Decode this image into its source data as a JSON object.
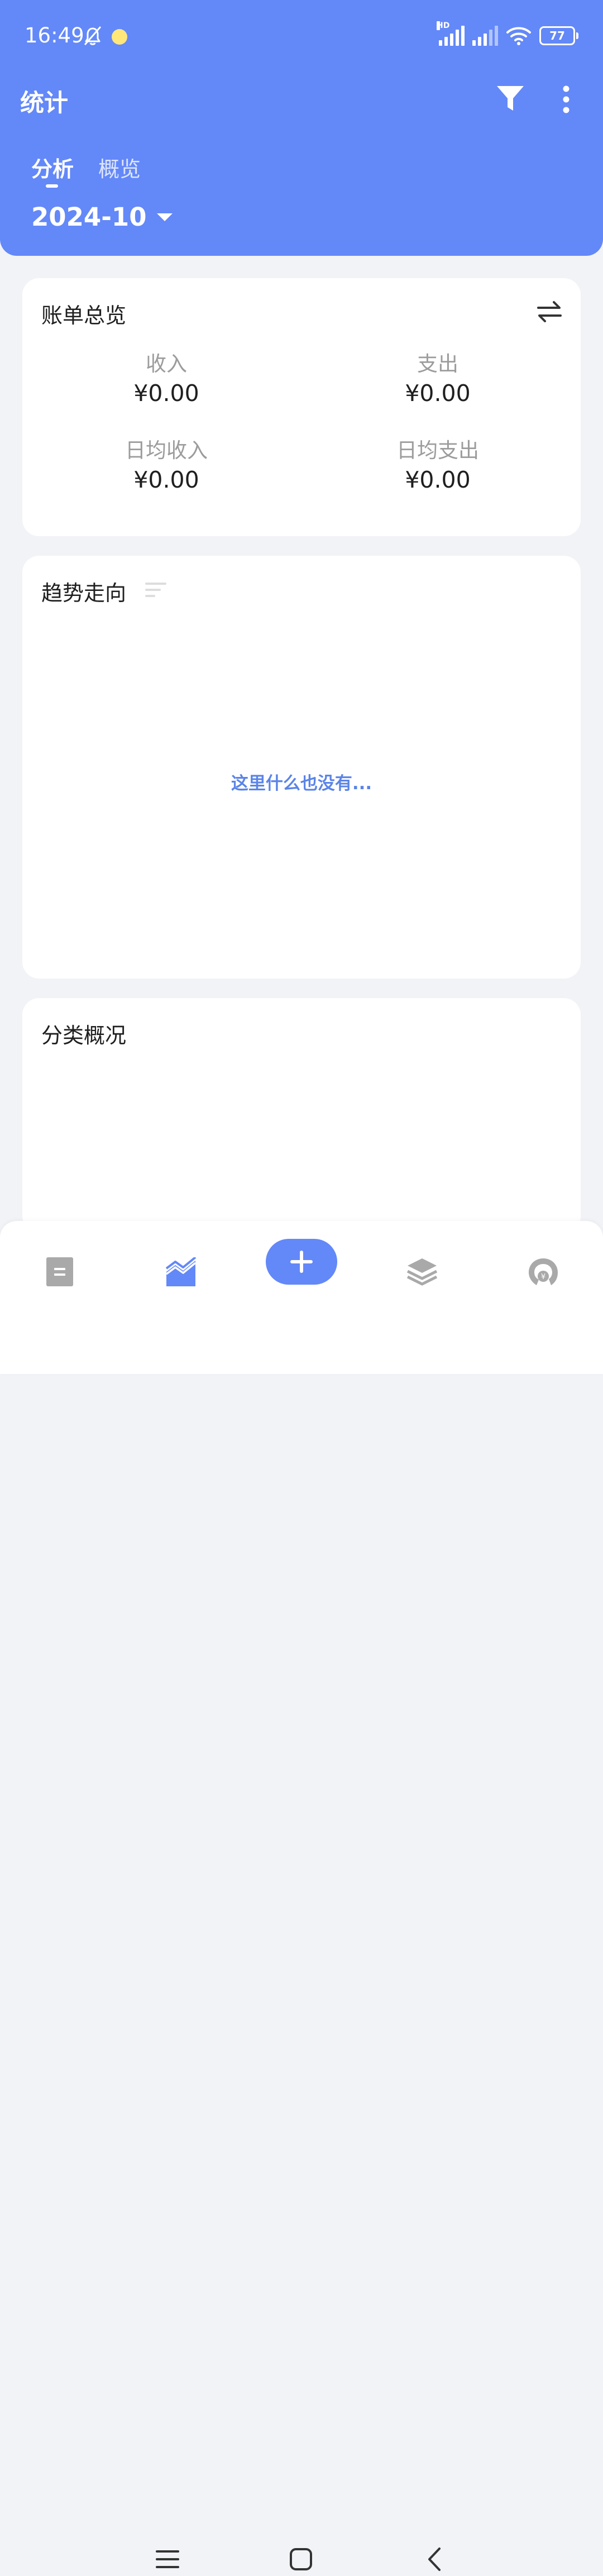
{
  "status_bar": {
    "time": "16:49",
    "network_label": "HD",
    "battery_level": "77",
    "icons": [
      "notifications-off-icon",
      "app-notification-icon",
      "signal-icon",
      "wifi-icon",
      "battery-icon"
    ]
  },
  "header": {
    "title": "统计",
    "tabs": [
      {
        "label": "分析",
        "active": true
      },
      {
        "label": "概览",
        "active": false
      }
    ],
    "month": "2024-10",
    "icons": [
      "filter-icon",
      "more-vertical-icon",
      "dropdown-arrow-icon"
    ]
  },
  "bill_overview": {
    "title": "账单总览",
    "stats": [
      {
        "label": "收入",
        "value": "¥0.00"
      },
      {
        "label": "支出",
        "value": "¥0.00"
      },
      {
        "label": "日均收入",
        "value": "¥0.00"
      },
      {
        "label": "日均支出",
        "value": "¥0.00"
      }
    ]
  },
  "trend": {
    "title": "趋势走向",
    "empty_text": "这里什么也没有..."
  },
  "category": {
    "title": "分类概况"
  },
  "bottom_nav": {
    "items": [
      "bills-icon",
      "statistics-icon",
      "add-icon",
      "layers-icon",
      "piggy-bank-icon"
    ]
  },
  "colors": {
    "primary": "#6388F8",
    "background": "#F2F3F7",
    "empty_text": "#5B84E8",
    "muted_text": "#9C9C9C"
  }
}
